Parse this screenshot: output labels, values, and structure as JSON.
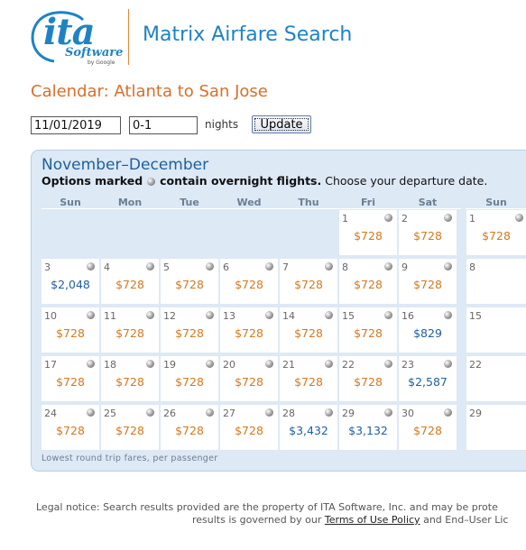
{
  "header": {
    "logo_text": "ita",
    "logo_software": "Software",
    "logo_google": "by Google",
    "app_title": "Matrix Airfare Search"
  },
  "calendar_title": "Calendar: Atlanta to San Jose",
  "controls": {
    "date_value": "11/01/2019",
    "nights_value": "0-1",
    "nights_label": "nights",
    "update_label": "Update"
  },
  "panel": {
    "month_heading": "November–December",
    "note_bold1": "Options marked",
    "note_bold2": "contain overnight flights.",
    "note_rest": "Choose your departure date.",
    "footer": "Lowest round trip fares, per passenger"
  },
  "days_of_week": [
    "Sun",
    "Mon",
    "Tue",
    "Wed",
    "Thu",
    "Fri",
    "Sat"
  ],
  "next_month_dow": "Sun",
  "weeks": [
    [
      null,
      null,
      null,
      null,
      null,
      {
        "day": "1",
        "fare": "$728",
        "tone": "orange"
      },
      {
        "day": "2",
        "fare": "$728",
        "tone": "orange"
      }
    ],
    [
      {
        "day": "3",
        "fare": "$2,048",
        "tone": "blue"
      },
      {
        "day": "4",
        "fare": "$728",
        "tone": "orange"
      },
      {
        "day": "5",
        "fare": "$728",
        "tone": "orange"
      },
      {
        "day": "6",
        "fare": "$728",
        "tone": "orange"
      },
      {
        "day": "7",
        "fare": "$728",
        "tone": "orange"
      },
      {
        "day": "8",
        "fare": "$728",
        "tone": "orange"
      },
      {
        "day": "9",
        "fare": "$728",
        "tone": "orange"
      }
    ],
    [
      {
        "day": "10",
        "fare": "$728",
        "tone": "orange"
      },
      {
        "day": "11",
        "fare": "$728",
        "tone": "orange"
      },
      {
        "day": "12",
        "fare": "$728",
        "tone": "orange"
      },
      {
        "day": "13",
        "fare": "$728",
        "tone": "orange"
      },
      {
        "day": "14",
        "fare": "$728",
        "tone": "orange"
      },
      {
        "day": "15",
        "fare": "$728",
        "tone": "orange"
      },
      {
        "day": "16",
        "fare": "$829",
        "tone": "blue"
      }
    ],
    [
      {
        "day": "17",
        "fare": "$728",
        "tone": "orange"
      },
      {
        "day": "18",
        "fare": "$728",
        "tone": "orange"
      },
      {
        "day": "19",
        "fare": "$728",
        "tone": "orange"
      },
      {
        "day": "20",
        "fare": "$728",
        "tone": "orange"
      },
      {
        "day": "21",
        "fare": "$728",
        "tone": "orange"
      },
      {
        "day": "22",
        "fare": "$728",
        "tone": "orange"
      },
      {
        "day": "23",
        "fare": "$2,587",
        "tone": "blue"
      }
    ],
    [
      {
        "day": "24",
        "fare": "$728",
        "tone": "orange"
      },
      {
        "day": "25",
        "fare": "$728",
        "tone": "orange"
      },
      {
        "day": "26",
        "fare": "$728",
        "tone": "orange"
      },
      {
        "day": "27",
        "fare": "$728",
        "tone": "orange"
      },
      {
        "day": "28",
        "fare": "$3,432",
        "tone": "blue"
      },
      {
        "day": "29",
        "fare": "$3,132",
        "tone": "blue"
      },
      {
        "day": "30",
        "fare": "$728",
        "tone": "orange"
      }
    ]
  ],
  "next_month_cells": [
    {
      "day": "1",
      "fare": "$728",
      "tone": "orange",
      "overnight": true
    },
    {
      "day": "8",
      "fare": "",
      "overnight": false
    },
    {
      "day": "15",
      "fare": "",
      "overnight": false
    },
    {
      "day": "22",
      "fare": "",
      "overnight": false
    },
    {
      "day": "29",
      "fare": "",
      "overnight": false
    }
  ],
  "legal": {
    "line1": "Legal notice: Search results provided are the property of ITA Software, Inc. and may be prote",
    "line2_prefix": "results is governed by our",
    "terms_link": "Terms of Use Policy",
    "line2_suffix": "and End–User Lic"
  },
  "colors": {
    "brand_blue": "#1e83c4",
    "accent_orange": "#d96f2a",
    "fare_blue": "#1e5f9e",
    "fare_orange": "#d4791e",
    "panel_bg": "#dde9f5"
  }
}
